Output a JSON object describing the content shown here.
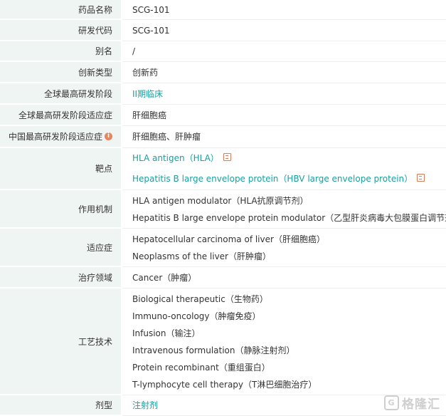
{
  "rows": [
    {
      "label": "药品名称",
      "values": [
        "SCG-101"
      ]
    },
    {
      "label": "研发代码",
      "values": [
        "SCG-101"
      ]
    },
    {
      "label": "别名",
      "values": [
        "/"
      ]
    },
    {
      "label": "创新类型",
      "values": [
        "创新药"
      ]
    },
    {
      "label": "全球最高研发阶段",
      "values": [
        "II期临床"
      ]
    },
    {
      "label": "全球最高研发阶段适应症",
      "values": [
        "肝细胞癌"
      ]
    },
    {
      "label": "中国最高研发阶段适应症",
      "info_icon": "info-icon",
      "values": [
        "肝细胞癌、肝肿瘤"
      ]
    },
    {
      "label": "靶点",
      "values": [
        "HLA antigen（HLA）",
        "Hepatitis B large envelope protein（HBV large envelope protein）"
      ]
    },
    {
      "label": "作用机制",
      "values": [
        "HLA antigen modulator（HLA抗原调节剂）",
        "Hepatitis B large envelope protein modulator（乙型肝炎病毒大包膜蛋白调节剂）"
      ]
    },
    {
      "label": "适应症",
      "values": [
        "Hepatocellular carcinoma of liver（肝细胞癌）",
        "Neoplasms of the liver（肝肿瘤）"
      ]
    },
    {
      "label": "治疗领域",
      "values": [
        "Cancer（肿瘤）"
      ]
    },
    {
      "label": "工艺技术",
      "values": [
        "Biological therapeutic（生物药）",
        "Immuno-oncology（肿瘤免疫）",
        "Infusion（输注）",
        "Intravenous formulation（静脉注射剂）",
        "Protein recombinant（重组蛋白）",
        "T-lymphocyte cell therapy（T淋巴细胞治疗）"
      ]
    },
    {
      "label": "剂型",
      "values": [
        "注射剂"
      ]
    }
  ],
  "watermark": {
    "logo": "G",
    "text": "格隆汇"
  },
  "colors": {
    "label_bg": "#eff5f2",
    "link": "#17a0a0",
    "icon_accent": "#e8845f"
  }
}
